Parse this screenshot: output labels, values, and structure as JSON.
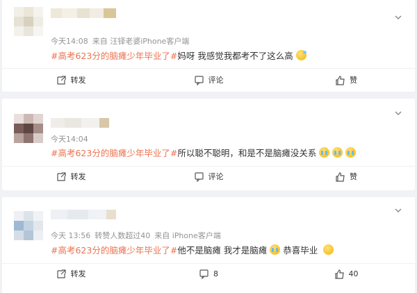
{
  "posts": [
    {
      "meta": {
        "time": "今天14:08",
        "source": "来自 汪铎老婆iPhone客户端"
      },
      "topic": "#高考623分的脑瘫少年毕业了#",
      "body": " 妈呀 我感觉我都考不了这么高",
      "emojis": [
        "sweat"
      ],
      "actions": {
        "repost": "转发",
        "comment": "评论",
        "like": "赞"
      }
    },
    {
      "meta": {
        "time": "今天14:04",
        "source": ""
      },
      "topic": "#高考623分的脑瘫少年毕业了#",
      "body": "所以聪不聪明，和是不是脑瘫没关系",
      "emojis": [
        "cry",
        "cry",
        "cry"
      ],
      "actions": {
        "repost": "转发",
        "comment": "评论",
        "like": "赞"
      }
    },
    {
      "meta": {
        "time": "今天 13:56",
        "extra": "转赞人数超过40",
        "source": "来自 iPhone客户端"
      },
      "topic": "#高考623分的脑瘫少年毕业了#",
      "body": "他不是脑瘫 我才是脑瘫",
      "body2": "恭喜毕业",
      "emojis": [
        "cry",
        "smile"
      ],
      "actions": {
        "repost": "转发",
        "comment": "8",
        "like": "40"
      }
    }
  ],
  "icons": {
    "repost": "repost-icon",
    "comment": "comment-icon",
    "like": "thumbs-up-icon",
    "menu": "chevron-down-icon"
  },
  "colors": {
    "topic": "#eb7350",
    "meta": "#939393",
    "background": "#f1f2f5"
  }
}
